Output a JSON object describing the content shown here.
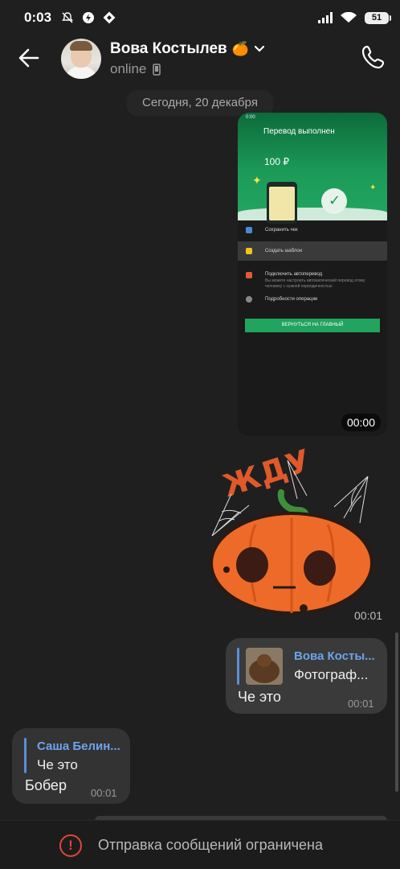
{
  "status_bar": {
    "time": "0:03",
    "battery": "51"
  },
  "header": {
    "contact_name": "Вова Костылев",
    "contact_emoji": "🍊",
    "status": "online"
  },
  "date_separator": "Сегодня, 20 декабря",
  "screenshot_message": {
    "status_time": "0:00",
    "title": "Перевод выполнен",
    "amount": "100 ₽",
    "rows": [
      "Сохранить чек",
      "Создать шаблон",
      "Подключить автоперевод",
      "Подробности операции"
    ],
    "autotransfer_note": "Вы можете настроить автоматический перевод этому человеку с нужной периодичностью",
    "button": "ВЕРНУТЬСЯ НА ГЛАВНЫЙ",
    "time": "00:00"
  },
  "sticker_message": {
    "word": "ЖДУ",
    "time": "00:01"
  },
  "outgoing_reply": {
    "reply_name": "Вова Косты...",
    "reply_text": "Фотограф...",
    "text": "Че это",
    "time": "00:01"
  },
  "incoming_reply": {
    "reply_name": "Саша Белин...",
    "reply_text": "Че это",
    "text": "Бобер",
    "time": "00:01"
  },
  "bottom_bar": {
    "text": "Отправка сообщений ограничена"
  },
  "colors": {
    "accent": "#5a8edb",
    "warning": "#e0453c",
    "sber_green": "#21a45d",
    "pumpkin": "#ee6a28"
  }
}
